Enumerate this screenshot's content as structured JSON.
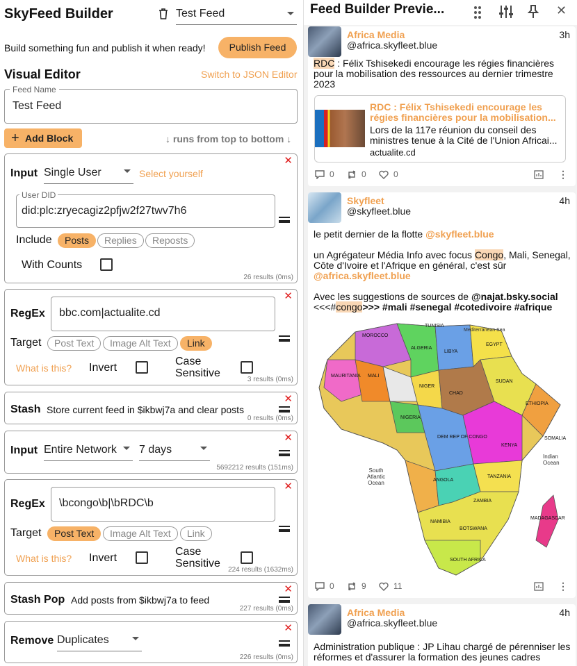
{
  "app": {
    "title": "SkyFeed Builder",
    "feed_select": "Test Feed",
    "tagline": "Build something fun and publish it when ready!",
    "publish_label": "Publish Feed"
  },
  "editor": {
    "title": "Visual Editor",
    "json_link": "Switch to JSON Editor",
    "feed_name_label": "Feed Name",
    "feed_name_value": "Test Feed",
    "add_block_label": "Add Block",
    "order_hint": "↓ runs from top to bottom ↓"
  },
  "blocks": [
    {
      "label": "Input",
      "mode": "Single User",
      "select_yourself": "Select yourself",
      "did_label": "User DID",
      "did_value": "did:plc:zryecagiz2pfjw2f27twv7h6",
      "include_label": "Include",
      "include_options": [
        "Posts",
        "Replies",
        "Reposts"
      ],
      "include_active": "Posts",
      "counts_label": "With Counts",
      "results": "26 results (0ms)"
    },
    {
      "label": "RegEx",
      "pattern": "bbc.com|actualite.cd",
      "target_label": "Target",
      "targets": [
        "Post Text",
        "Image Alt Text",
        "Link"
      ],
      "target_active": "Link",
      "what": "What is this?",
      "invert": "Invert",
      "case": "Case Sensitive",
      "results": "3 results (0ms)"
    },
    {
      "label": "Stash",
      "desc": "Store current feed in $ikbwj7a and clear posts",
      "results": "0 results (0ms)"
    },
    {
      "label": "Input",
      "mode": "Entire Network",
      "range": "7 days",
      "results": "5692212 results (151ms)"
    },
    {
      "label": "RegEx",
      "pattern": "\\bcongo\\b|\\bRDC\\b",
      "target_label": "Target",
      "targets": [
        "Post Text",
        "Image Alt Text",
        "Link"
      ],
      "target_active": "Post Text",
      "what": "What is this?",
      "invert": "Invert",
      "case": "Case Sensitive",
      "results": "224 results (1632ms)"
    },
    {
      "label": "Stash Pop",
      "desc": "Add posts from $ikbwj7a to feed",
      "results": "227 results (0ms)"
    },
    {
      "label": "Remove",
      "mode": "Duplicates",
      "results": "226 results (0ms)"
    }
  ],
  "preview": {
    "title": "Feed Builder Previe...",
    "posts": [
      {
        "name": "Africa Media",
        "handle": "@africa.skyfleet.blue",
        "time": "3h",
        "text_hl": "RDC",
        "text_rest": " : Félix Tshisekedi encourage les régies financières pour la mobilisation des ressources au dernier trimestre 2023",
        "card_title": "RDC : Félix Tshisekedi encourage les régies financières pour la mobilisation...",
        "card_desc": "Lors de la 117e réunion du conseil des ministres tenue à la Cité de l'Union Africai...",
        "card_domain": "actualite.cd",
        "replies": "0",
        "reposts": "0",
        "likes": "0"
      },
      {
        "name": "Skyfleet",
        "handle": "@skyfleet.blue",
        "time": "4h",
        "l1_text": "le petit dernier de la flotte ",
        "l1_mention": "@skyfleet.blue",
        "l2_a": "un Agrégateur Média Info avec focus ",
        "l2_hl": "Congo",
        "l2_b": ", Mali, Senegal, Côte d'Ivoire et l'Afrique en général, c'est sûr ",
        "l2_mention": "@africa.skyfleet.blue",
        "l3_a": "Avec les suggestions de sources de ",
        "l3_mention": "@najat.bsky.social",
        "l3_b": "<<<#",
        "l3_hl": "congo",
        "l3_c": ">>> #mali #senegal #cotedivoire #afrique",
        "replies": "0",
        "reposts": "9",
        "likes": "11"
      },
      {
        "name": "Africa Media",
        "handle": "@africa.skyfleet.blue",
        "time": "4h",
        "text": "Administration publique : JP Lihau chargé de pérenniser les réformes et d'assurer la formation des jeunes cadres"
      }
    ],
    "map_labels": {
      "sea": "Mediterranean Sea",
      "atlantic": "South Atlantic Ocean",
      "indian": "Indian Ocean",
      "c1": "ALGERIA",
      "c2": "LIBYA",
      "c3": "EGYPT",
      "c4": "NIGER",
      "c5": "CHAD",
      "c6": "SUDAN",
      "c7": "DEM REP OF CONGO",
      "c8": "ANGOLA",
      "c9": "NAMIBIA",
      "c10": "TANZANIA",
      "c11": "ETHIOPIA",
      "c12": "SOUTH AFRICA",
      "c13": "MALI",
      "c14": "MAURITANIA",
      "c15": "KENYA",
      "c16": "MADAGASCAR",
      "c17": "BOTSWANA",
      "c18": "ZAMBIA",
      "c19": "MOROCCO",
      "c20": "TUNISIA",
      "c21": "SOMALIA",
      "c22": "NIGERIA"
    }
  },
  "colors": {
    "accent": "#f7b267",
    "accent_text": "#f0a050",
    "danger": "#e02020",
    "map_sea": "#ffffff"
  }
}
